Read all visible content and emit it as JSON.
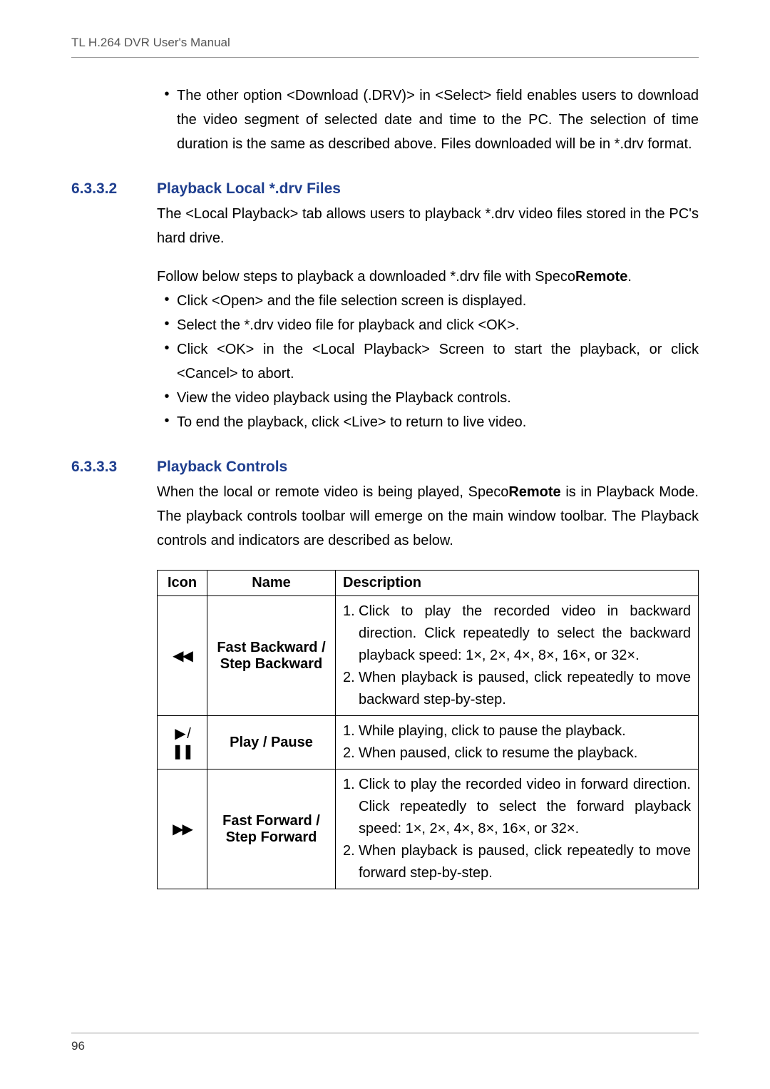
{
  "header_title": "TL H.264 DVR User's Manual",
  "page_number": "96",
  "intro_bullet": "The other option <Download (.DRV)> in <Select> field enables users to download the video segment of selected date and time to the PC. The selection of time duration is the same as described above. Files downloaded will be in *.drv format.",
  "section_6332": {
    "num": "6.3.3.2",
    "title": "Playback Local *.drv Files",
    "p1": "The <Local Playback> tab allows users to playback *.drv video files stored in the PC's hard drive.",
    "p2_pre": "Follow below steps to playback a downloaded *.drv file with Speco",
    "p2_bold": "Remote",
    "p2_post": ".",
    "bullets": [
      "Click <Open> and the file selection screen is displayed.",
      "Select the *.drv video file for playback and click <OK>.",
      "Click <OK> in the <Local Playback> Screen to start the playback, or click <Cancel> to abort.",
      "View the video playback using the Playback controls.",
      "To end the playback, click <Live> to return to live video."
    ]
  },
  "section_6333": {
    "num": "6.3.3.3",
    "title": "Playback Controls",
    "p1_pre": "When the local or remote video is being played, Speco",
    "p1_bold": "Remote",
    "p1_post": " is in Playback Mode. The playback controls toolbar will emerge on the main window toolbar. The Playback controls and indicators are described as below.",
    "table": {
      "headers": {
        "icon": "Icon",
        "name": "Name",
        "desc": "Description"
      },
      "rows": [
        {
          "icon": "◀◀",
          "name": "Fast Backward / Step Backward",
          "desc": [
            "Click to play the recorded video in backward direction. Click repeatedly to select the backward playback speed: 1×, 2×, 4×, 8×, 16×, or 32×.",
            "When playback is paused, click repeatedly to move backward step-by-step."
          ]
        },
        {
          "icon": "▶ / ❚❚",
          "name": "Play / Pause",
          "desc": [
            "While playing, click to pause the playback.",
            "When paused, click to resume the playback."
          ]
        },
        {
          "icon": "▶▶",
          "name": "Fast Forward / Step Forward",
          "desc": [
            "Click to play the recorded video in forward direction. Click repeatedly to select the forward playback speed: 1×, 2×, 4×, 8×, 16×, or 32×.",
            "When playback is paused, click repeatedly to move forward step-by-step."
          ]
        }
      ]
    }
  }
}
